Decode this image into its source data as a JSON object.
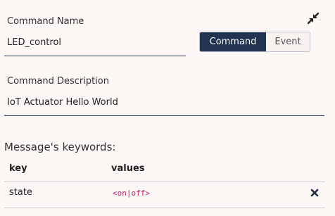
{
  "command_name": {
    "label": "Command Name",
    "value": "LED_control"
  },
  "command_type": {
    "options": [
      "Command",
      "Event"
    ],
    "selected": "Command"
  },
  "command_description": {
    "label": "Command Description",
    "value": "IoT Actuator Hello World"
  },
  "keywords": {
    "title": "Message's keywords:",
    "columns": [
      "key",
      "values"
    ],
    "rows": [
      {
        "key": "state",
        "values": "<on|off>"
      }
    ]
  },
  "colors": {
    "accent": "#233352",
    "values_text": "#c0256e",
    "background": "#fdf8f6"
  },
  "icons": {
    "collapse": "collapse-arrows-icon",
    "delete": "delete-x-icon"
  }
}
